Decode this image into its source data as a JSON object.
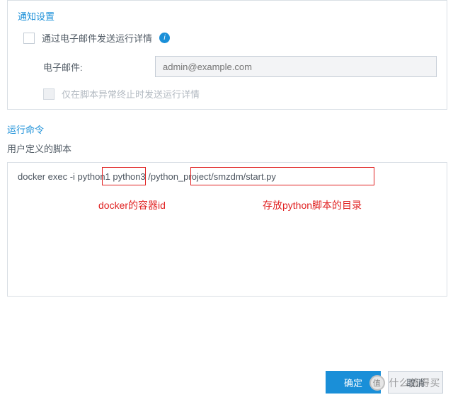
{
  "notification": {
    "title": "通知设置",
    "email_checkbox_label": "通过电子邮件发送运行详情",
    "email_label": "电子邮件:",
    "email_placeholder": "admin@example.com",
    "abnormal_only_label": "仅在脚本异常终止时发送运行详情"
  },
  "command": {
    "title": "运行命令",
    "sub_label": "用户定义的脚本",
    "script_text": "docker exec -i python1 python3 /python_project/smzdm/start.py",
    "anno_container": "docker的容器id",
    "anno_path": "存放python脚本的目录"
  },
  "buttons": {
    "ok": "确定",
    "cancel": "取消"
  },
  "watermark": {
    "badge": "值",
    "text": "什么值得买"
  }
}
